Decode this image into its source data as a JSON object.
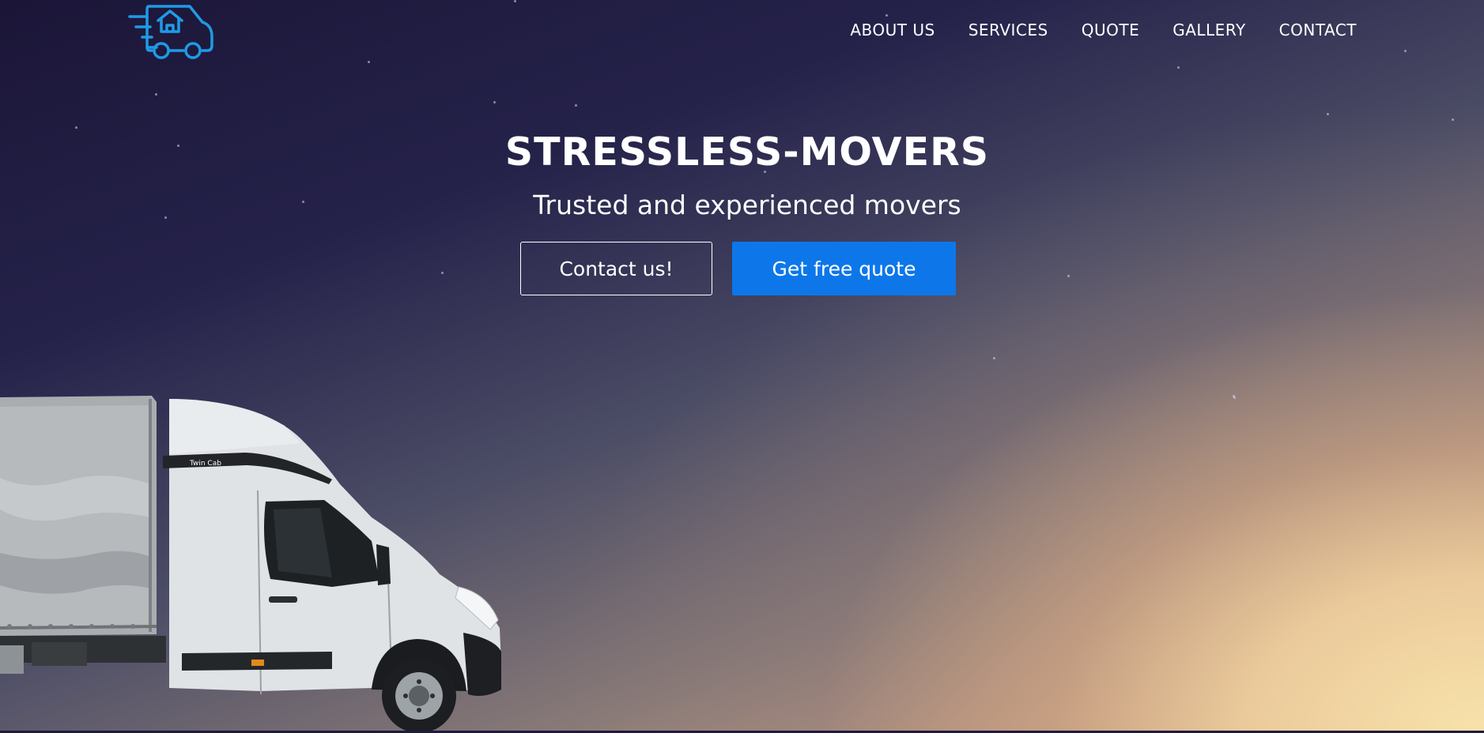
{
  "header": {
    "logo_icon": "moving-truck-house-icon",
    "nav": [
      {
        "label": "ABOUT US"
      },
      {
        "label": "SERVICES"
      },
      {
        "label": "QUOTE"
      },
      {
        "label": "GALLERY"
      },
      {
        "label": "CONTACT"
      }
    ]
  },
  "hero": {
    "title": "STRESSLESS-MOVERS",
    "subtitle": "Trusted and experienced movers",
    "contact_button": "Contact us!",
    "quote_button": "Get free quote",
    "truck_badge": "Twin Cab"
  },
  "colors": {
    "accent": "#0d77ea",
    "logo": "#1e9be6",
    "text": "#ffffff",
    "sky_top": "#1b1638",
    "sky_bottom": "#f3dca5"
  }
}
